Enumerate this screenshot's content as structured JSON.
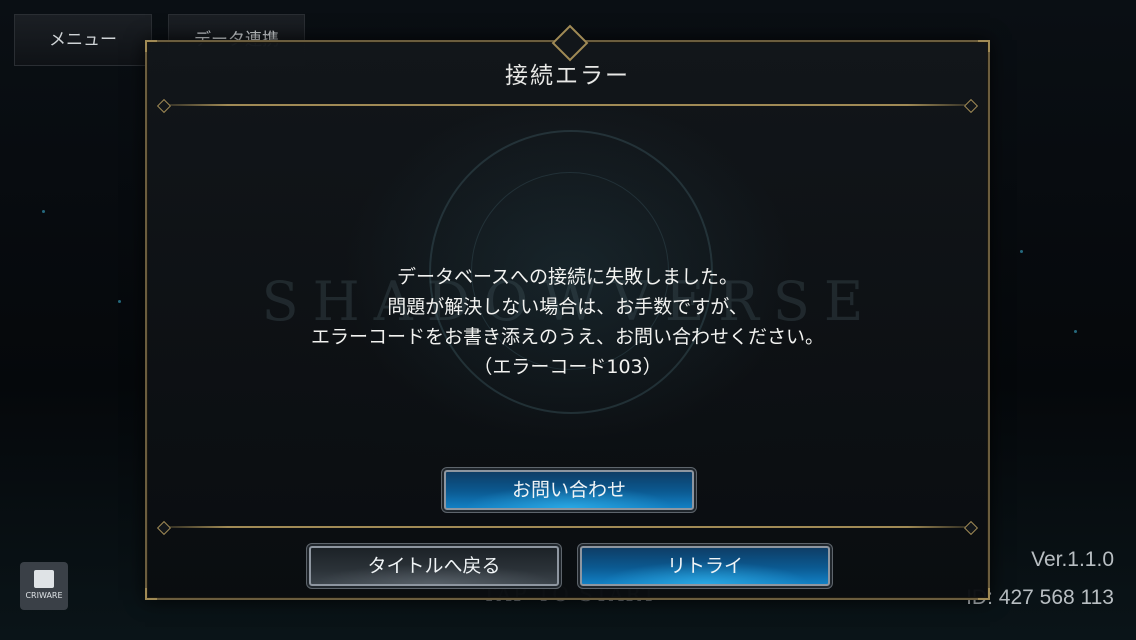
{
  "header": {
    "menu_label": "メニュー",
    "data_link_label": "データ連携"
  },
  "background": {
    "logo_text": "SHADOWVERSE",
    "tap_to_start": "TAP TO START",
    "version": "Ver.1.1.0",
    "player_id": "ID: 427 568 113",
    "criware_label": "CRIWARE"
  },
  "dialog": {
    "title": "接続エラー",
    "message_lines": [
      "データベースへの接続に失敗しました。",
      "問題が解決しない場合は、お手数ですが、",
      "エラーコードをお書き添えのうえ、お問い合わせください。",
      "（エラーコード103）"
    ],
    "contact_button": "お問い合わせ",
    "back_to_title_button": "タイトルへ戻る",
    "retry_button": "リトライ"
  },
  "colors": {
    "accent_gold": "#a08a55",
    "button_blue": "#0b5a92",
    "text": "#f2f2f0"
  }
}
